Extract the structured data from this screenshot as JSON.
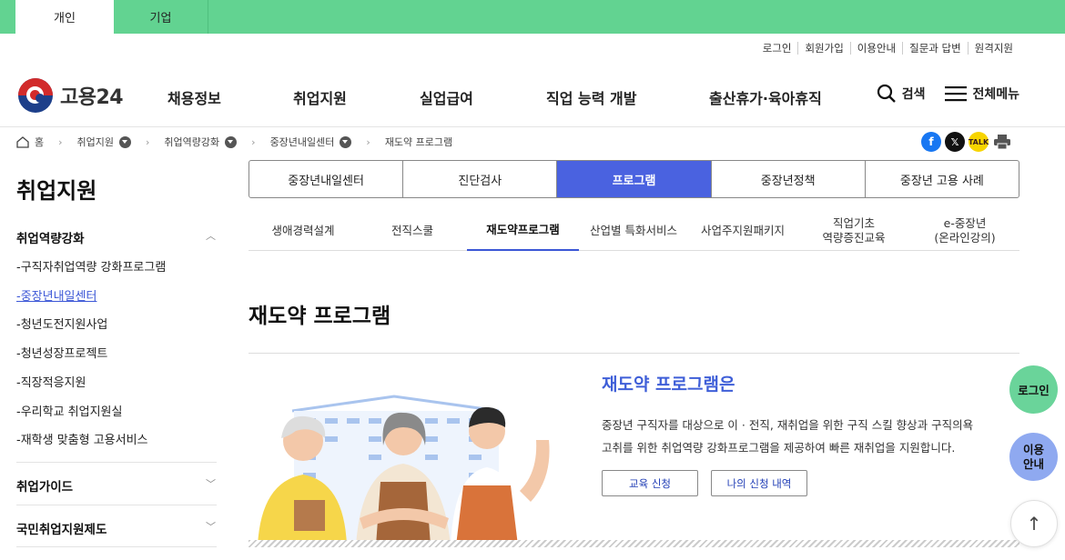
{
  "topbar": {
    "tab_personal": "개인",
    "tab_company": "기업"
  },
  "util_links": [
    "로그인",
    "회원가입",
    "이용안내",
    "질문과 답변",
    "원격지원"
  ],
  "logo": {
    "text": "고용24"
  },
  "gnb": [
    "채용정보",
    "취업지원",
    "실업급여",
    "직업 능력 개발",
    "출산휴가·육아휴직"
  ],
  "header_right": {
    "search": "검색",
    "menu": "전체메뉴"
  },
  "breadcrumb": {
    "home": "홈",
    "items": [
      "취업지원",
      "취업역량강화",
      "중장년내일센터",
      "재도약 프로그램"
    ]
  },
  "share_icons": [
    "facebook-icon",
    "x-icon",
    "kakaotalk-icon",
    "print-icon"
  ],
  "sidebar": {
    "title": "취업지원",
    "groups": [
      {
        "label": "취업역량강화",
        "expanded": true
      },
      {
        "label": "취업가이드",
        "expanded": false
      },
      {
        "label": "국민취업지원제도",
        "expanded": false
      }
    ],
    "sub_items": [
      "-구직자취업역량 강화프로그램",
      "-중장년내일센터",
      "-청년도전지원사업",
      "-청년성장프로젝트",
      "-직장적응지원",
      "-우리학교 취업지원실",
      "-재학생 맞춤형 고용서비스"
    ],
    "active_sub": "-중장년내일센터"
  },
  "tabs": [
    "중장년내일센터",
    "진단검사",
    "프로그램",
    "중장년정책",
    "중장년 고용 사례"
  ],
  "active_tab": "프로그램",
  "subtabs": [
    "생애경력설계",
    "전직스쿨",
    "재도약프로그램",
    "산업별 특화서비스",
    "사업주지원패키지",
    "직업기초\n역량증진교육",
    "e-중장년\n(온라인강의)"
  ],
  "active_subtab": "재도약프로그램",
  "page_title": "재도약 프로그램",
  "intro": {
    "title": "재도약 프로그램은",
    "line1": "중장년 구직자를 대상으로 이 · 전직, 재취업을 위한 구직 스킬 향상과 구직의욕",
    "line2": "고취를 위한 취업역량 강화프로그램을 제공하여 빠른 재취업을 지원합니다.",
    "btn_apply": "교육 신청",
    "btn_history": "나의 신청 내역"
  },
  "floating": {
    "login": "로그인",
    "guide_line1": "이용",
    "guide_line2": "안내",
    "top": "↑"
  },
  "colors": {
    "topbar": "#62d391",
    "accent": "#4a62e0",
    "link": "#3b56d6"
  }
}
